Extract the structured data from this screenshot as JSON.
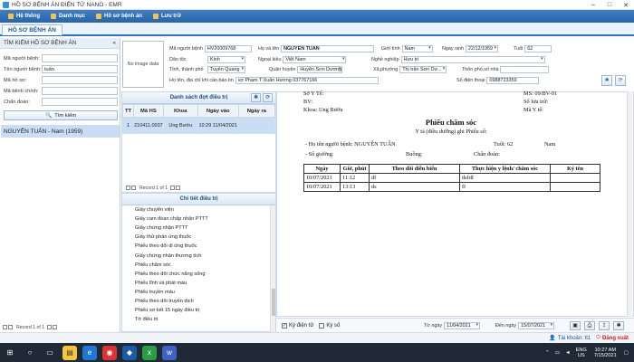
{
  "window": {
    "title": "HỒ SƠ BỆNH ÁN ĐIỆN TỬ NANO - EMR"
  },
  "menu": [
    {
      "label": "Hệ thống",
      "icon": "gear-icon"
    },
    {
      "label": "Danh mục",
      "icon": "folder-icon"
    },
    {
      "label": "Hồ sơ bệnh án",
      "icon": "record-icon"
    },
    {
      "label": "Lưu trữ",
      "icon": "archive-icon"
    }
  ],
  "tabs": [
    {
      "label": "HỒ SƠ BỆNH ÁN"
    }
  ],
  "search": {
    "title": "TÌM KIẾM HỒ SƠ BỆNH ÁN",
    "fields": [
      {
        "label": "Mã người bệnh:",
        "value": ""
      },
      {
        "label": "Tên người bệnh:",
        "value": "tuấn"
      },
      {
        "label": "Mã hồ sơ:",
        "value": ""
      },
      {
        "label": "Mã bệnh chính:",
        "value": ""
      },
      {
        "label": "Chẩn đoán:",
        "value": ""
      }
    ],
    "button": "Tìm kiếm",
    "results": [
      "NGUYỄN TUẤN - Nam (1959)"
    ],
    "pager": "Record 1 of 1"
  },
  "patient": {
    "no_image": "No image data",
    "ma_nb_label": "Mã người bệnh",
    "ma_nb": "HV20009768",
    "hoten_label": "Họ và tên",
    "hoten": "NGUYỄN TUẤN",
    "gioitinh_label": "Giới tính",
    "gioitinh": "Nam",
    "ngaysinh_label": "Ngày sinh",
    "ngaysinh": "22/12/1959",
    "tuoi_label": "Tuổi",
    "tuoi": "62",
    "dantoc_label": "Dân tộc",
    "dantoc": "Kinh",
    "ngoaikieu_label": "Ngoại kiều",
    "ngoaikieu": "Việt Nam",
    "nghenghiep_label": "Nghề nghiệp",
    "nghenghiep": "Hưu trí",
    "tinh_label": "Tỉnh, thành phố",
    "tinh": "Tuyên Quang",
    "quan_label": "Quận huyện",
    "quan": "Huyện Sơn Dương",
    "xa_label": "Xã,phường",
    "xa": "Thị trấn Sơn Dư...",
    "thon_label": "Thôn phố,số nhà",
    "thon": "",
    "lienhe_label": "Họ tên, địa chỉ khi cần báo tin",
    "lienhe": "vợ Phạm T Xuân Hương 037767166",
    "sdt_label": "Số điện thoại",
    "sdt": "0988723359"
  },
  "visits": {
    "title": "Danh sách đợt điều trị",
    "columns": [
      "TT",
      "Mã HS",
      "Khoa",
      "Ngày vào",
      "Ngày ra"
    ],
    "rows": [
      {
        "tt": "1",
        "mahs": "210411.0037",
        "khoa": "Ung Bướu",
        "ngayvao": "10:29 11/04/2021",
        "ngayra": ""
      }
    ],
    "pager": "Record 1 of 1"
  },
  "docs": {
    "title": "Chi tiết điều trị",
    "items": [
      "Giấy chuyển viện",
      "Giấy cam đoan chấp nhận PTTT",
      "Giấy chứng nhận PTTT",
      "Giấy thử phản ứng thuốc",
      "Phiếu theo dõi dị ứng thuốc",
      "Giấy chứng nhận thương tích",
      "Phiếu chăm sóc",
      "Phiếu theo dõi chức năng sống",
      "Phiếu lĩnh và phát máu",
      "Phiếu truyền máu",
      "Phiếu theo dõi truyền dịch",
      "Phiếu sơ kết 15 ngày điều trị",
      "Tờ điều trị"
    ]
  },
  "sheet": {
    "soyte": "Sở Y Tế:",
    "bv": "BV:",
    "khoa": "Khoa: Ung Bướu",
    "ms": "MS: 09/BV-01",
    "soluutru": "Số lưu trữ:",
    "mayte": "Mã Y tế:",
    "title": "Phiếu chăm sóc",
    "subtitle": "Y tá (điều dưỡng) ghi    Phiếu số:",
    "hoten": "- Họ tên người bệnh: NGUYỄN TUẤN",
    "tuoi": "Tuổi: 62",
    "gt": "Nam",
    "giuong": "- Số giường:",
    "buong": "Buồng:",
    "chandoan": "Chẩn đoán:",
    "columns": [
      "Ngày",
      "Giờ, phút",
      "Theo dõi diễn biến",
      "Thực hiện y lệnh/ chăm sóc",
      "Ký tên"
    ],
    "rows": [
      [
        "10/07/2021",
        "11:12",
        "df",
        "dsfdf",
        ""
      ],
      [
        "10/07/2021",
        "13:13",
        "ds",
        "ff",
        ""
      ]
    ]
  },
  "bottom": {
    "kydientu": "Ký điện tử",
    "kyso": "Ký số",
    "tungay_label": "Từ ngày",
    "tungay": "11/04/2021",
    "denngay_label": "Đến ngày",
    "denngay": "15/07/2021"
  },
  "status": {
    "account": "Tài khoản: tt1",
    "logout": "Đăng xuất"
  },
  "taskbar": {
    "lang": "ENG",
    "region": "US",
    "time": "10:27 AM",
    "date": "7/15/2021"
  }
}
